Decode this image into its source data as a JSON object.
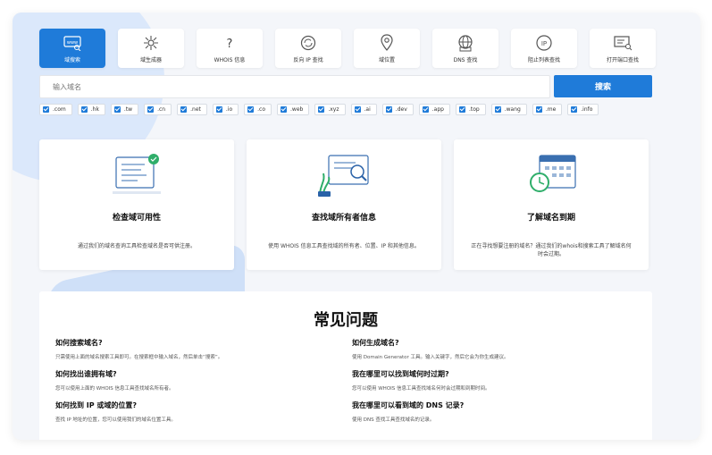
{
  "tools": [
    {
      "label": "域搜索",
      "icon": "domain-www-icon",
      "active": true
    },
    {
      "label": "域生成器",
      "icon": "network-generator-icon",
      "active": false
    },
    {
      "label": "WHOIS 信息",
      "icon": "question-icon",
      "active": false
    },
    {
      "label": "反向 IP 查找",
      "icon": "reverse-ip-icon",
      "active": false
    },
    {
      "label": "域位置",
      "icon": "location-pin-icon",
      "active": false
    },
    {
      "label": "DNS 查找",
      "icon": "dns-globe-icon",
      "active": false
    },
    {
      "label": "阻止列表查找",
      "icon": "ip-badge-icon",
      "active": false
    },
    {
      "label": "打开端口查找",
      "icon": "port-scan-icon",
      "active": false
    }
  ],
  "search": {
    "placeholder": "输入域名",
    "button_label": "搜索"
  },
  "tlds": [
    ".com",
    ".hk",
    ".tw",
    ".cn",
    ".net",
    ".io",
    ".co",
    ".web",
    ".xyz",
    ".ai",
    ".dev",
    ".app",
    ".top",
    ".wang",
    ".me",
    ".info"
  ],
  "cards": [
    {
      "title": "检查域可用性",
      "desc": "通过我们的域名查询工具检查域名是否可供注册。",
      "icon": "availability-screen-icon"
    },
    {
      "title": "查找域所有者信息",
      "desc": "使用 WHOIS 信息工具查找域的所有者、位置、IP 和其他信息。",
      "icon": "owner-search-icon"
    },
    {
      "title": "了解域名到期",
      "desc": "正在寻找想要注册的域名？通过我们的whois和搜索工具了解域名何时会过期。",
      "icon": "expiry-calendar-icon"
    }
  ],
  "faq": {
    "title": "常见问题",
    "left": [
      {
        "q": "如何搜索域名?",
        "a": "只需使用上面的域名搜索工具即可。在搜索框中输入域名，然后单击“搜索”。"
      },
      {
        "q": "如何找出谁拥有域?",
        "a": "您可以使用上面的 WHOIS 信息工具查找域名所有者。"
      },
      {
        "q": "如何找到 IP 或域的位置?",
        "a": "查找 IP 地址的位置，您可以使用我们的域名位置工具。"
      }
    ],
    "right": [
      {
        "q": "如何生成域名?",
        "a": "使用 Domain Generator 工具。输入关键字，然后它会为你生成建议。"
      },
      {
        "q": "我在哪里可以找到域何时过期?",
        "a": "您可以使用 WHOIS 信息工具查找域名何时会过期和到期时间。"
      },
      {
        "q": "我在哪里可以看到域的 DNS 记录?",
        "a": "使用 DNS 查找工具查找域名的记录。"
      }
    ]
  },
  "colors": {
    "accent": "#1f7bd9",
    "background": "#f4f6fa",
    "blob": "#dbe8fb"
  }
}
